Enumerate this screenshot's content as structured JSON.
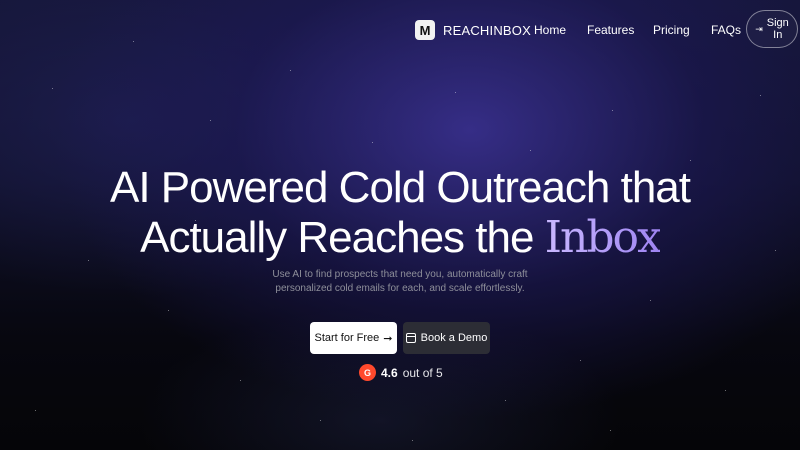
{
  "nav": {
    "logo_mark": "M",
    "brand": "REACHINBOX",
    "links": [
      "Home",
      "Features",
      "Pricing",
      "FAQs"
    ],
    "signin": {
      "icon": "sign-in-arrow-icon",
      "label": "Sign In"
    }
  },
  "hero": {
    "headline_line1": "AI Powered Cold Outreach that",
    "headline_line2_prefix": "Actually Reaches the ",
    "headline_highlight": "Inbox",
    "subtitle": "Use AI to find prospects that need you, automatically craft personalized cold emails for each, and scale effortlessly.",
    "cta_primary": "Start for Free",
    "cta_primary_arrow": "➞",
    "cta_secondary": "Book a Demo",
    "cta_secondary_icon": "calendar-icon"
  },
  "rating": {
    "badge": "G",
    "score": "4.6",
    "suffix": "out of 5"
  },
  "colors": {
    "highlight_start": "#c9b8ff",
    "highlight_end": "#9e84f2",
    "g2_red": "#ff492c",
    "demo_button_bg": "#2c2d35"
  }
}
